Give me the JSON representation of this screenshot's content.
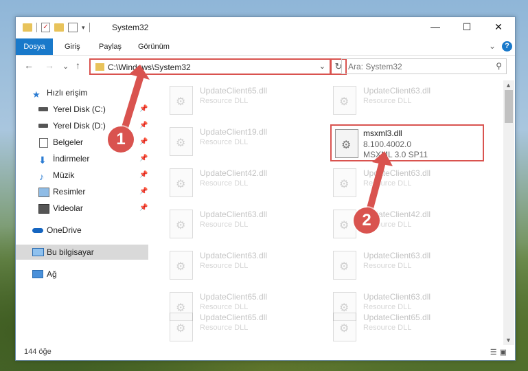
{
  "window": {
    "title": "System32",
    "minimize": "—",
    "maximize": "☐",
    "close": "✕"
  },
  "ribbon": {
    "tabs": [
      "Dosya",
      "Giriş",
      "Paylaş",
      "Görünüm"
    ],
    "help": "?"
  },
  "navigation": {
    "back": "←",
    "forward": "→",
    "recent": "⌄",
    "up": "↑",
    "address": "C:\\Windows\\System32",
    "refresh": "↻",
    "search_placeholder": "Ara: System32"
  },
  "sidebar": {
    "items": [
      {
        "label": "Hızlı erişim",
        "icon": "star-icon"
      },
      {
        "label": "Yerel Disk (C:)",
        "icon": "drive-icon"
      },
      {
        "label": "Yerel Disk (D:)",
        "icon": "drive-icon"
      },
      {
        "label": "Belgeler",
        "icon": "documents-icon"
      },
      {
        "label": "İndirmeler",
        "icon": "downloads-icon"
      },
      {
        "label": "Müzik",
        "icon": "music-icon"
      },
      {
        "label": "Resimler",
        "icon": "pictures-icon"
      },
      {
        "label": "Videolar",
        "icon": "videos-icon"
      },
      {
        "label": "OneDrive",
        "icon": "cloud-icon"
      },
      {
        "label": "Bu bilgisayar",
        "icon": "computer-icon"
      },
      {
        "label": "Ağ",
        "icon": "network-icon"
      }
    ]
  },
  "files": [
    {
      "name": "UpdateClient65.dll",
      "desc": "Resource DLL"
    },
    {
      "name": "UpdateClient63.dll",
      "desc": "Resource DLL"
    },
    {
      "name": "UpdateClient19.dll",
      "desc": "Resource DLL"
    },
    {
      "name": "msxml3.dll",
      "version": "8.100.4002.0",
      "desc": "MSXML 3.0 SP11"
    },
    {
      "name": "UpdateClient42.dll",
      "desc": "Resource DLL"
    },
    {
      "name": "UpdateClient63.dll",
      "desc": "Resource DLL"
    },
    {
      "name": "UpdateClient63.dll",
      "desc": "Resource DLL"
    },
    {
      "name": "UpdateClient42.dll",
      "desc": "Resource DLL"
    },
    {
      "name": "UpdateClient63.dll",
      "desc": "Resource DLL"
    },
    {
      "name": "UpdateClient63.dll",
      "desc": "Resource DLL"
    },
    {
      "name": "UpdateClient65.dll",
      "desc": "Resource DLL"
    },
    {
      "name": "UpdateClient63.dll",
      "desc": "Resource DLL"
    },
    {
      "name": "UpdateClient65.dll",
      "desc": "Resource DLL"
    },
    {
      "name": "UpdateClient65.dll",
      "desc": "Resource DLL"
    }
  ],
  "status": {
    "count": "144 öğe"
  },
  "annotations": {
    "step1": "1",
    "step2": "2",
    "color": "#d9534f"
  }
}
